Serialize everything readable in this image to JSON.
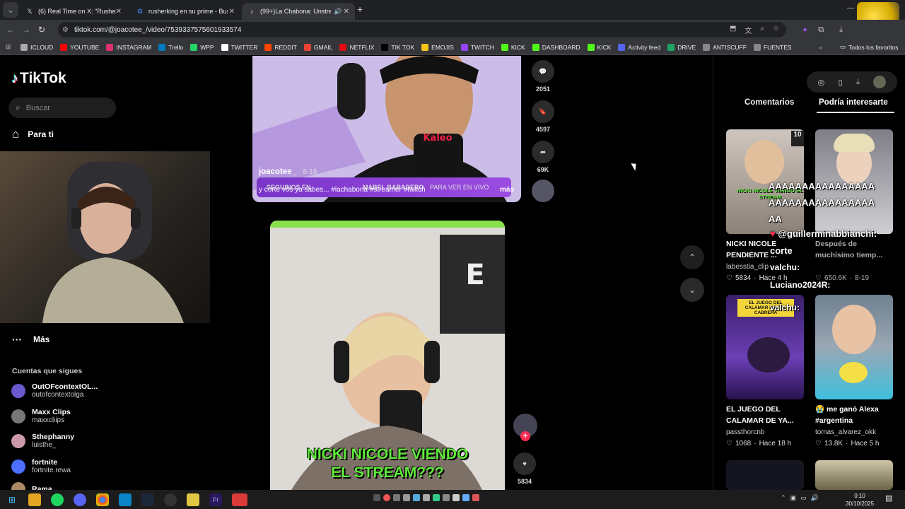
{
  "browser": {
    "tabs": [
      {
        "title": "(6) Real Time on X: \"Rusherking",
        "icon": "x-icon"
      },
      {
        "title": "rusherking en su prime - Busca",
        "icon": "google-icon"
      },
      {
        "title": "(99+)La Chabona: Unstrean",
        "icon": "tiktok-icon"
      }
    ],
    "url": "tiktok.com/@joacotee_/video/7539337575601933574",
    "bookmarks": [
      "ICLOUD",
      "YOUTUBE",
      "INSTAGRAM",
      "Trello",
      "WPP",
      "TWITTER",
      "REDDIT",
      "GMAIL",
      "NETFLIX",
      "TIK TOK",
      "EMOJIS",
      "TWITCH",
      "KICK",
      "DASHBOARD",
      "KICK",
      "Activity feed",
      "DRIVE",
      "ANTISCUFF",
      "FUENTES"
    ],
    "all_favorites": "Todos los favoritos",
    "corner_overlay": "x6"
  },
  "sidebar": {
    "logo": "TikTok",
    "search_placeholder": "Buscar",
    "for_you": "Para ti",
    "more": "Más",
    "following_title": "Cuentas que sigues",
    "accounts": [
      {
        "name": "OutOFcontextOL...",
        "handle": "outofcontextolga"
      },
      {
        "name": "Maxx Clips",
        "handle": "maxxcliips"
      },
      {
        "name": "Sthephanny",
        "handle": "luisthe_"
      },
      {
        "name": "fortnite",
        "handle": "fortnite.rewa"
      },
      {
        "name": "Rama",
        "handle": ""
      }
    ]
  },
  "video1": {
    "author": "joacotee_",
    "date": "· 8-16",
    "caption": "y corte vos ya sabes... #lachabona #streamer #twitch",
    "more": "más",
    "banner": "SEGUINOS EN",
    "banner2": "MABEL BARADERO",
    "banner3": "PARA VER EN VIVO",
    "comments": "2051",
    "saves": "4597",
    "shares": "69K"
  },
  "video2": {
    "overlay_line1": "NICKI NICOLE VIENDO",
    "overlay_line2": "EL STREAM???",
    "likes": "5834"
  },
  "right_panel": {
    "tab_comments": "Comentarios",
    "tab_interest": "Podría interesarte",
    "cards": [
      {
        "title": "NICKI NICOLE",
        "title2": "PENDIENTE ...",
        "user": "labesstia_clip",
        "likes": "5834",
        "time": "Hace 4 h",
        "thumb_text": "NICKI NICOLE VIENDO EL STREAM"
      },
      {
        "title": "Después de",
        "title2": "muchísimo tiemp...",
        "user": "",
        "likes": "650.6K",
        "time": "8-19",
        "thumb_text": ""
      },
      {
        "title": "EL JUEGO DEL",
        "title2": "CALAMAR DE YA...",
        "user": "passthorcnb",
        "likes": "1068",
        "time": "Hace 18 h",
        "thumb_text": "EL JUEGO DEL CALAMAR DE YAO CABRERA"
      },
      {
        "title": "😭 me ganó Alexa",
        "title2": "#argentina",
        "user": "tomas_alvarez_okk",
        "likes": "13.8K",
        "time": "Hace 5 h",
        "thumb_text": ""
      }
    ]
  },
  "chat_overlay": {
    "line1": "AAAAAAAAAAAAAAAA",
    "line2": "AAAAAAAAAAAAAAAA",
    "line3": "AA",
    "user1": "@guillerminabbianchi:",
    "msg1": "corte",
    "user2": "valchu:",
    "user3": "Luciano2024R:",
    "user4": "valchu:"
  },
  "taskbar": {
    "time": "0:10",
    "date": "30/10/2025"
  }
}
